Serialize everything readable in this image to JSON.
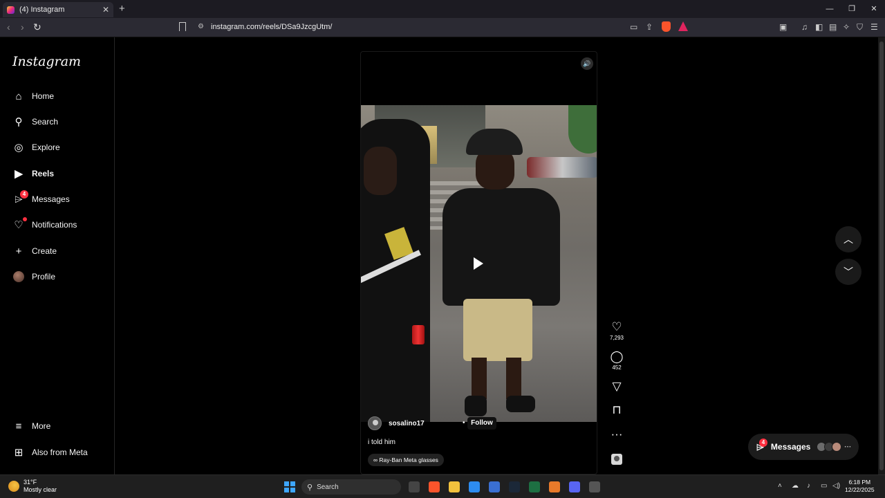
{
  "browser": {
    "tab_title": "(4) Instagram",
    "tab_close": "✕",
    "new_tab": "+",
    "url": "instagram.com/reels/DSa9JzcgUtm/"
  },
  "sidebar": {
    "logo": "Instagram",
    "items": [
      {
        "label": "Home",
        "icon": "home-icon"
      },
      {
        "label": "Search",
        "icon": "search-icon"
      },
      {
        "label": "Explore",
        "icon": "compass-icon"
      },
      {
        "label": "Reels",
        "icon": "reels-icon"
      },
      {
        "label": "Messages",
        "icon": "messenger-icon",
        "badge": "4"
      },
      {
        "label": "Notifications",
        "icon": "heart-icon"
      },
      {
        "label": "Create",
        "icon": "plus-icon"
      },
      {
        "label": "Profile",
        "icon": "avatar"
      }
    ],
    "more": "More",
    "also_from_meta": "Also from Meta"
  },
  "reel": {
    "author": "sosalino17",
    "follow_separator": "•",
    "follow_label": "Follow",
    "caption": "i told him",
    "tag": "Ray-Ban Meta glasses",
    "likes": "7,293",
    "comments": "452"
  },
  "messages_pill": {
    "label": "Messages",
    "badge": "4"
  },
  "taskbar": {
    "temperature": "31°F",
    "weather": "Mostly clear",
    "search_label": "Search",
    "time": "6:18 PM",
    "date": "12/22/2025"
  },
  "colors": {
    "background": "#000000",
    "notification_badge": "#ff3040",
    "sidebar_border": "#262626"
  }
}
